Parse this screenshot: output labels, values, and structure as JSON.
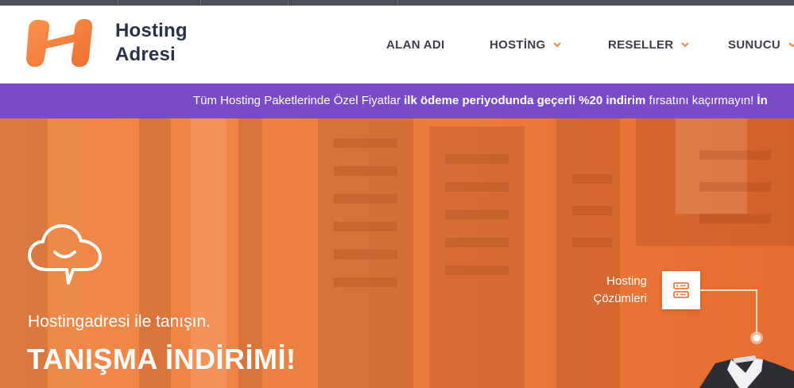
{
  "brand": {
    "line1": "Hosting",
    "line2": "Adresi",
    "logo_color": "#f0783a",
    "text_color": "#2a3246"
  },
  "nav": {
    "items": [
      {
        "label": "ALAN ADI",
        "has_dropdown": false
      },
      {
        "label": "HOSTİNG",
        "has_dropdown": true
      },
      {
        "label": "RESELLER",
        "has_dropdown": true
      },
      {
        "label": "SUNUCU",
        "has_dropdown": true
      }
    ],
    "chevron_color": "#ef8a3a"
  },
  "promo": {
    "part1": "Tüm Hosting Paketlerinde Özel Fiyatlar ",
    "bold1": "ilk ödeme periyodunda geçerli %20 indirim",
    "part2": " fırsatını kaçırmayın! ",
    "bold2": "İn",
    "bg_color": "#7a4bc9"
  },
  "hero": {
    "subtitle": "Hostingadresi ile tanışın.",
    "title": "TANIŞMA İNDİRİMİ!",
    "icon": "cloud-chat-icon",
    "solutions_label_line1": "Hosting",
    "solutions_label_line2": "Çözümleri",
    "solutions_icon": "server-icon",
    "accent_color": "#ec7f40"
  }
}
